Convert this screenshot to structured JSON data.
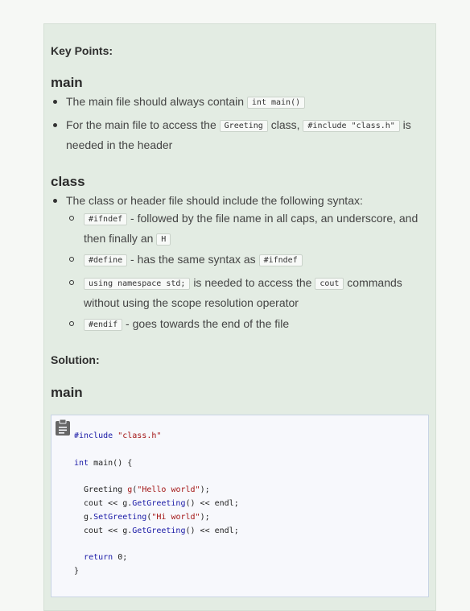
{
  "key_points_heading": "Key Points:",
  "main_section": {
    "heading": "main",
    "items": [
      {
        "before": "The main file should always contain",
        "code": "int main()",
        "after": ""
      },
      {
        "before": "For the main file to access the",
        "code1": "Greeting",
        "middle": "class,",
        "code2": "#include \"class.h\"",
        "after1": "is",
        "line2": "needed in the header"
      }
    ]
  },
  "class_section": {
    "heading": "class",
    "intro": "The class or header file should include the following syntax:",
    "subitems": [
      {
        "code": "#ifndef",
        "text": "- followed by the file name in all caps, an underscore, and",
        "line2": "then finally an",
        "code2": "H"
      },
      {
        "code": "#define",
        "text": "- has the same syntax as",
        "code2": "#ifndef"
      },
      {
        "code": "using namespace std;",
        "text": "is needed to access the",
        "code2": "cout",
        "text2": "commands",
        "line2": "without using the scope resolution operator"
      },
      {
        "code": "#endif",
        "text": "- goes towards the end of the file"
      }
    ]
  },
  "solution_heading": "Solution:",
  "solution_main_heading": "main",
  "code_block": {
    "line1_pre": "#include",
    "line1_str": "\"class.h\"",
    "line2_kw": "int",
    "line2_rest": "main() {",
    "line3_pre": "  Greeting ",
    "line3_fn": "g",
    "line3_open": "(",
    "line3_str": "\"Hello world\"",
    "line3_close": ");",
    "line4_pre": "  cout << g.",
    "line4_fn": "GetGreeting",
    "line4_post": "() << endl;",
    "line5_pre": "  g.",
    "line5_fn": "SetGreeting",
    "line5_open": "(",
    "line5_str": "\"Hi world\"",
    "line5_close": ");",
    "line6_pre": "  cout << g.",
    "line6_fn": "GetGreeting",
    "line6_post": "() << endl;",
    "line7_kw": "return",
    "line7_rest": " 0;",
    "line8": "}"
  },
  "icons": {
    "clipboard": "clipboard-icon"
  },
  "colors": {
    "panel_bg": "#e3ece3",
    "code_bg": "#f7f8fc",
    "keyword": "#1a1aa6",
    "string": "#a31515"
  }
}
